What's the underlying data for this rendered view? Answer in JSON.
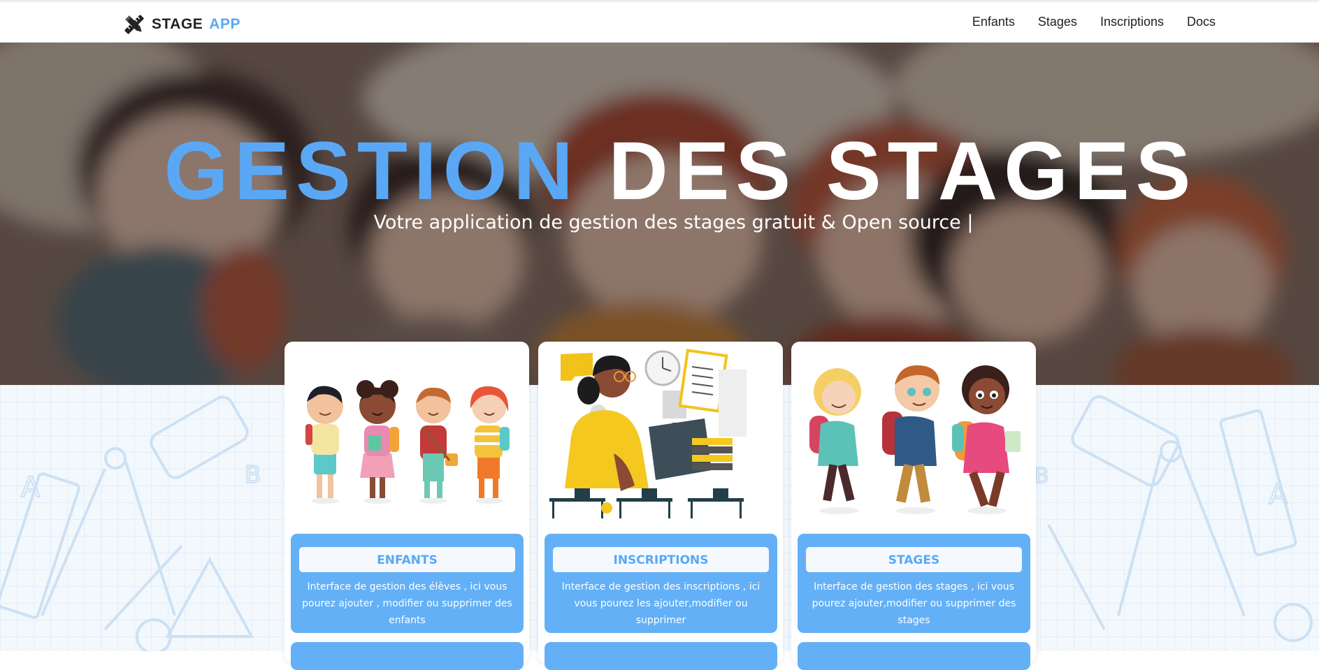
{
  "navbar": {
    "brand_stage": "STAGE",
    "brand_app": "APP",
    "links": [
      "Enfants",
      "Stages",
      "Inscriptions",
      "Docs"
    ]
  },
  "hero": {
    "title_blue": "GESTION",
    "title_white": "DES STAGES",
    "subtitle": "Votre application de gestion des stages gratuit & Open source |"
  },
  "cards": [
    {
      "button_label": "ENFANTS",
      "description": "Interface de gestion des élèves , ici vous pourez ajouter , modifier ou supprimer des enfants"
    },
    {
      "button_label": "INSCRIPTIONS",
      "description": "Interface de gestion des inscriptions , ici vous pourez les ajouter,modifier ou supprimer"
    },
    {
      "button_label": "STAGES",
      "description": "Interface de gestion des stages , ici vous pourez ajouter,modifier ou supprimer des stages"
    }
  ],
  "colors": {
    "accent": "#5aa8f5",
    "panel": "#63b0f7",
    "text_dark": "#222222"
  },
  "icons": [
    "pencil-ruler-logo-icon"
  ]
}
